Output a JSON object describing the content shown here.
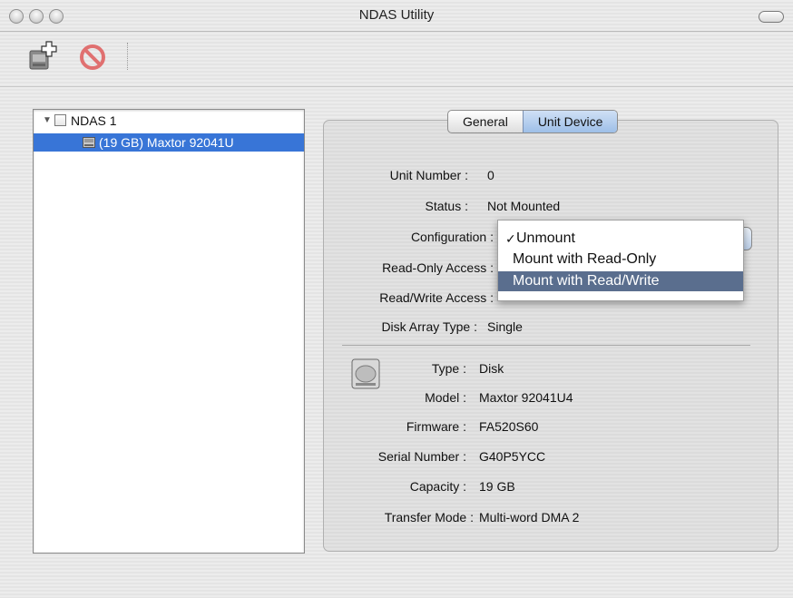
{
  "window": {
    "title": "NDAS Utility"
  },
  "toolbar": {
    "buttons": [
      {
        "name": "add-device"
      },
      {
        "name": "remove-device"
      }
    ]
  },
  "tree": {
    "device": {
      "label": "NDAS 1"
    },
    "unit": {
      "label": "(19 GB) Maxtor 92041U"
    }
  },
  "tabs": [
    {
      "label": "General"
    },
    {
      "label": "Unit Device"
    }
  ],
  "unit_info": {
    "unit_number": {
      "label": "Unit Number :",
      "value": "0"
    },
    "status": {
      "label": "Status :",
      "value": "Not Mounted"
    },
    "configuration": {
      "label": "Configuration :"
    },
    "read_only_access": {
      "label": "Read-Only Access :"
    },
    "read_write_access": {
      "label": "Read/Write Access :"
    },
    "disk_array_type": {
      "label": "Disk Array Type  :",
      "value": "Single"
    }
  },
  "config_menu": {
    "items": [
      {
        "label": "Unmount",
        "checked": "✓"
      },
      {
        "label": "Mount with Read-Only"
      },
      {
        "label": "Mount with Read/Write"
      }
    ],
    "highlight_color": "#5a6e8e"
  },
  "disk_info": {
    "type": {
      "label": "Type :",
      "value": "Disk"
    },
    "model": {
      "label": "Model :",
      "value": "Maxtor 92041U4"
    },
    "firmware": {
      "label": "Firmware :",
      "value": "FA520S60"
    },
    "serial": {
      "label": "Serial Number :",
      "value": "G40P5YCC"
    },
    "capacity": {
      "label": "Capacity :",
      "value": "19 GB"
    },
    "transfer_mode": {
      "label": "Transfer Mode  :",
      "value": "Multi-word DMA 2"
    }
  },
  "colors": {
    "selection": "#3875d7",
    "tab_active": "#9ebfe8"
  }
}
